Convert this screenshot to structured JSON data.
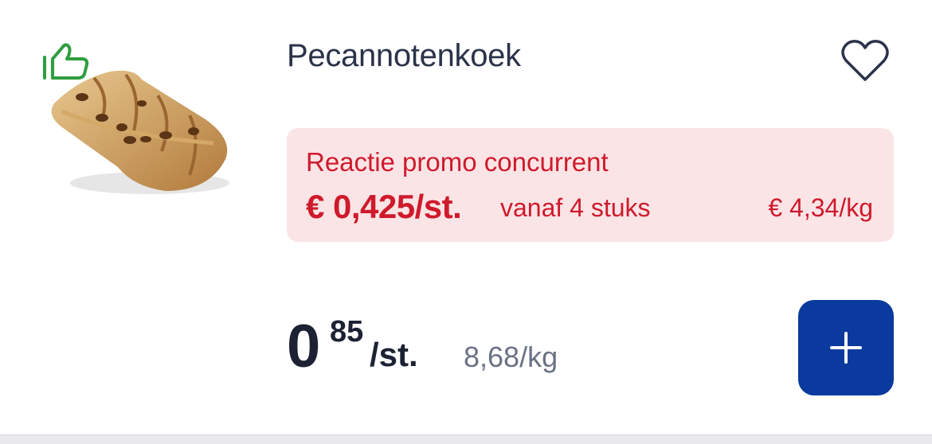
{
  "product": {
    "name": "Pecannotenkoek",
    "image_icon": "pastry-product-image",
    "badge_icon": "thumbs-up-icon",
    "favorite_icon": "heart-icon"
  },
  "promo": {
    "label": "Reactie promo concurrent",
    "price": "€ 0,425/st.",
    "condition": "vanaf 4 stuks",
    "price_per_kg": "€ 4,34/kg"
  },
  "price": {
    "integer": "0",
    "decimals": "85",
    "unit": "/st.",
    "per_kg": "8,68/kg"
  },
  "actions": {
    "add_icon": "plus-icon"
  },
  "colors": {
    "promo_red": "#cf1a2c",
    "promo_bg": "#fbe4e6",
    "brand_blue": "#0a3a9e",
    "badge_green": "#2f9e3f",
    "text_dark": "#2b3349"
  }
}
